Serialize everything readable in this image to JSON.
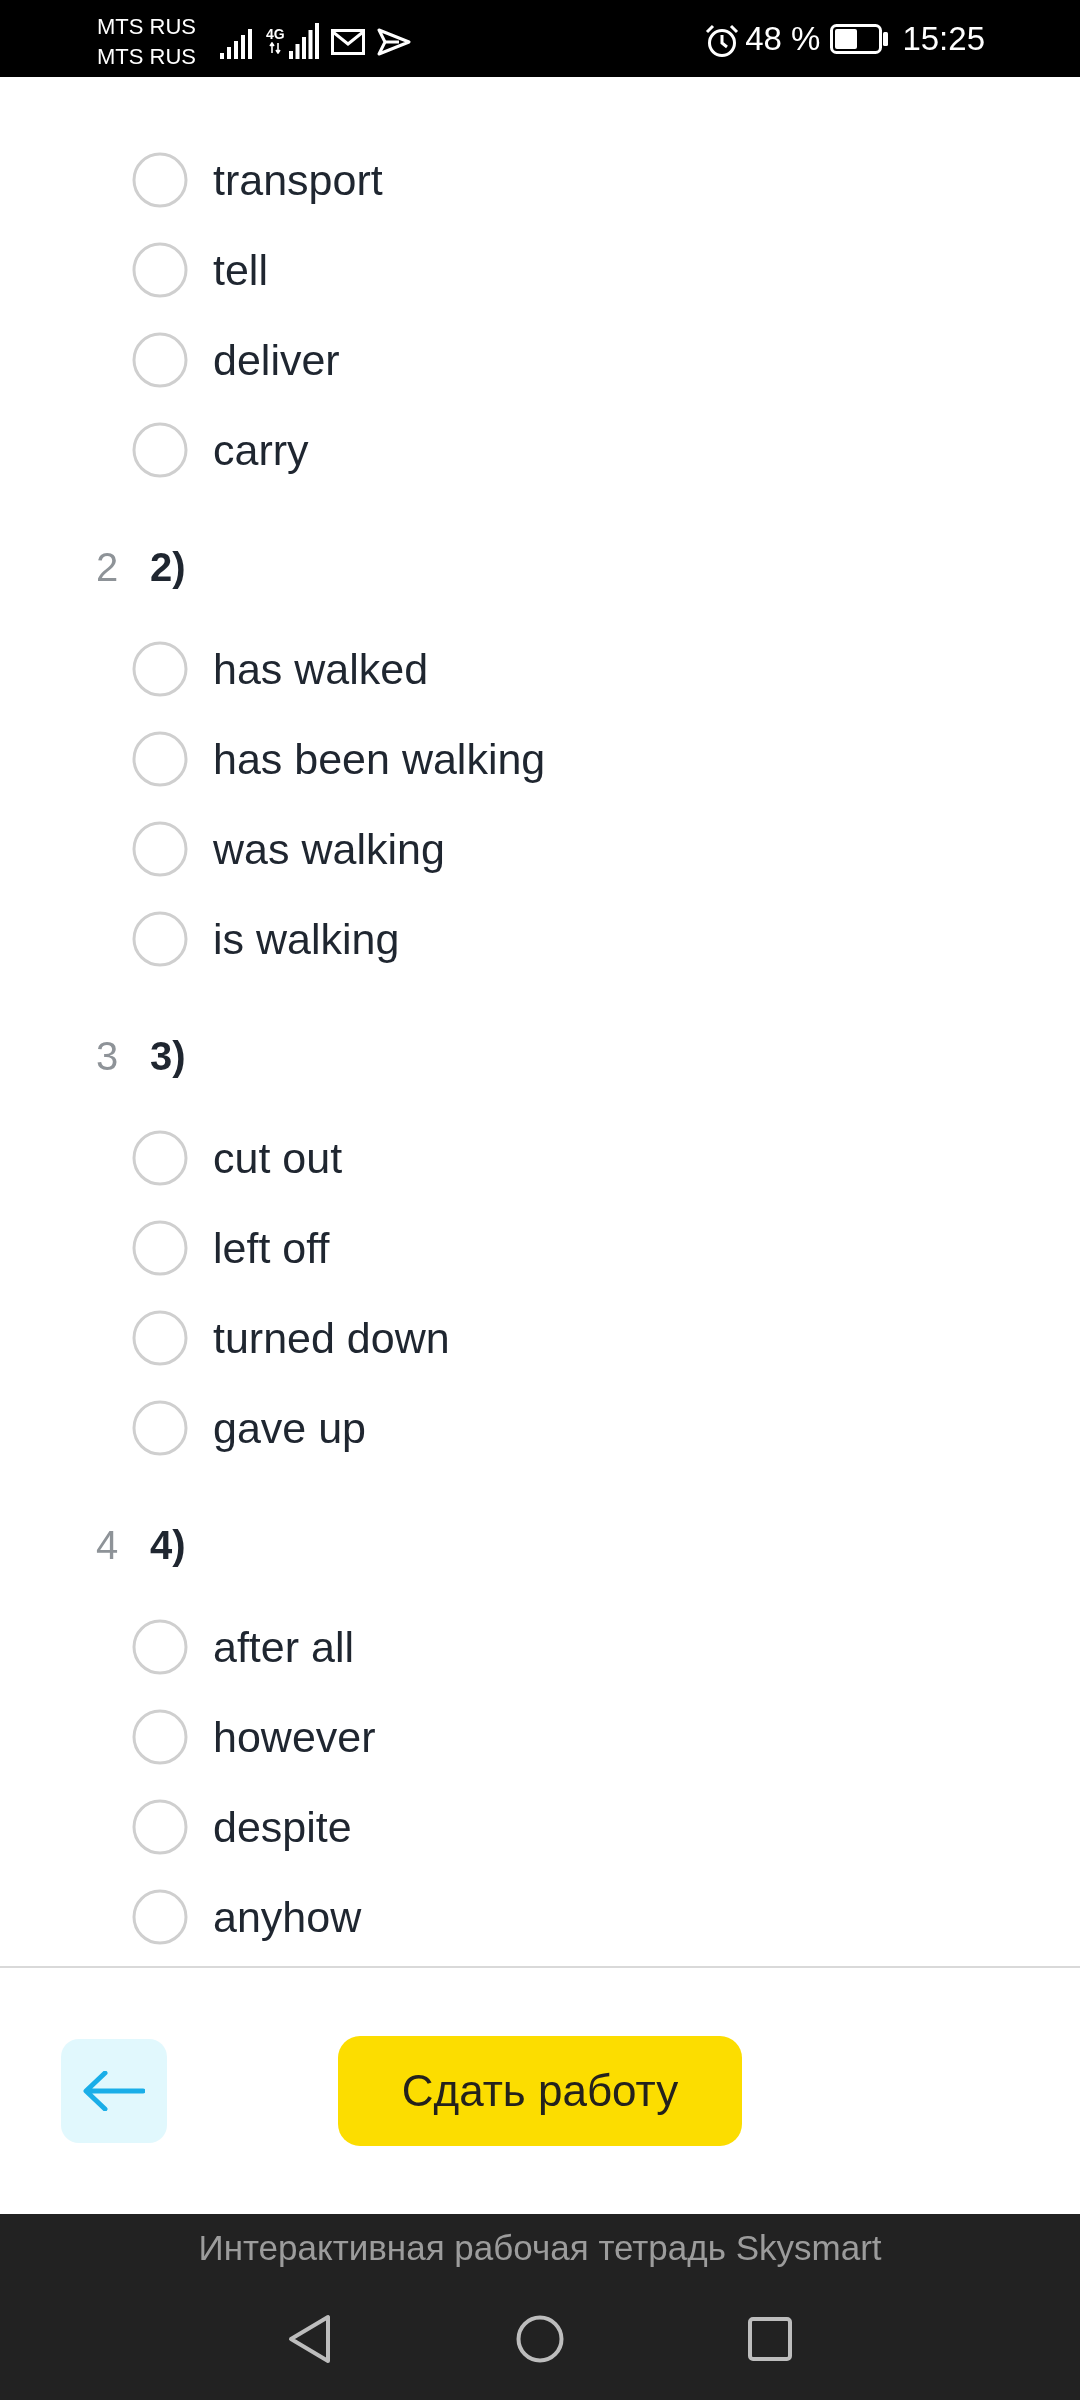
{
  "status_bar": {
    "carriers": [
      "MTS RUS",
      "MTS RUS"
    ],
    "network": "4G",
    "battery": "48 %",
    "time": "15:25"
  },
  "questions": [
    {
      "options": [
        {
          "text": "transport",
          "selected": false
        },
        {
          "text": "tell",
          "selected": false
        },
        {
          "text": "deliver",
          "selected": false
        },
        {
          "text": "carry",
          "selected": false
        }
      ]
    },
    {
      "number": "2",
      "label": "2)",
      "options": [
        {
          "text": "has walked",
          "selected": false
        },
        {
          "text": "has been walking",
          "selected": false
        },
        {
          "text": "was walking",
          "selected": false
        },
        {
          "text": "is walking",
          "selected": false
        }
      ]
    },
    {
      "number": "3",
      "label": "3)",
      "options": [
        {
          "text": "cut out",
          "selected": false
        },
        {
          "text": "left off",
          "selected": false
        },
        {
          "text": "turned down",
          "selected": false
        },
        {
          "text": "gave up",
          "selected": false
        }
      ]
    },
    {
      "number": "4",
      "label": "4)",
      "options": [
        {
          "text": "after all",
          "selected": false
        },
        {
          "text": "however",
          "selected": false
        },
        {
          "text": "despite",
          "selected": false
        },
        {
          "text": "anyhow",
          "selected": false
        }
      ]
    }
  ],
  "footer": {
    "submit_button": "Сдать работу"
  },
  "app_bar": {
    "caption": "Интерактивная рабочая тетрадь Skysmart"
  }
}
